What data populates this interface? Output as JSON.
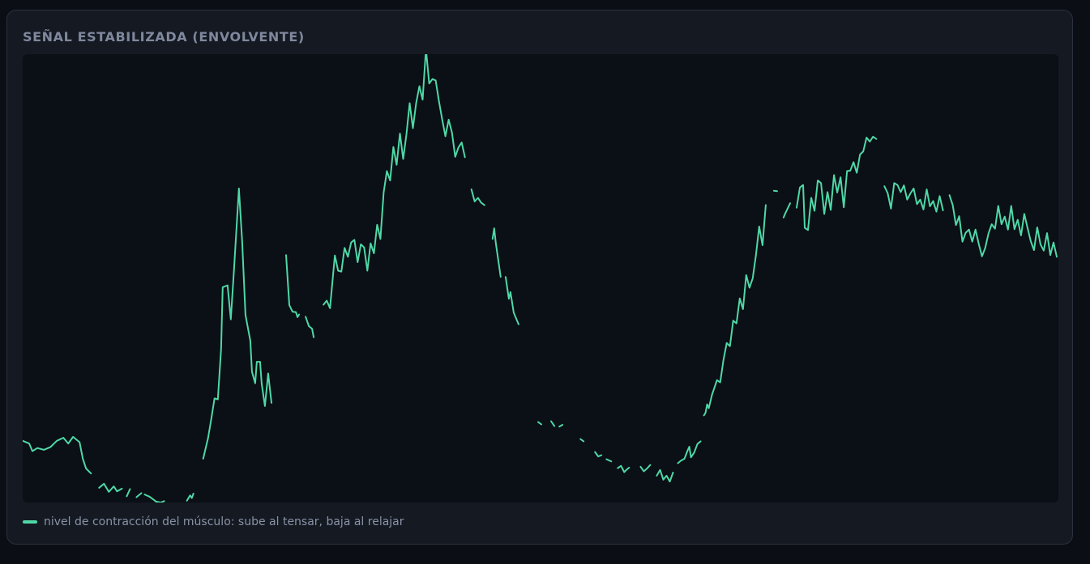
{
  "panel": {
    "title": "SEÑAL ESTABILIZADA (ENVOLVENTE)"
  },
  "colors": {
    "background": "#0b0f15",
    "panel": "#141922",
    "plot_area": "#0b0f16",
    "series": "#4fd8a6",
    "title": "#7f889c",
    "legend_text": "#8a93a6"
  },
  "chart_data": {
    "type": "line",
    "title": "SEÑAL ESTABILIZADA (ENVOLVENTE)",
    "xlabel": "",
    "ylabel": "",
    "xlim": [
      0,
      637
    ],
    "ylim": [
      0,
      100
    ],
    "grid": false,
    "axes_visible": false,
    "legend_position": "bottom-left",
    "series": [
      {
        "name": "nivel de contracción del músculo: sube al tensar, baja al relajar",
        "color": "#4fd8a6",
        "segments": [
          {
            "x": [
              0,
              4,
              6,
              9,
              13,
              17,
              21,
              25,
              28,
              31,
              35,
              37,
              39,
              42
            ],
            "y": [
              13.8,
              13.2,
              11.5,
              12.2,
              11.8,
              12.4,
              13.8,
              14.5,
              13.2,
              14.7,
              13.5,
              9.8,
              7.6,
              6.5
            ]
          },
          {
            "x": [
              47,
              50,
              53,
              56,
              58,
              61
            ],
            "y": [
              3.3,
              4.2,
              2.4,
              3.6,
              2.5,
              3.1
            ]
          },
          {
            "x": [
              64,
              66
            ],
            "y": [
              1.4,
              3.0
            ]
          },
          {
            "x": [
              70,
              73
            ],
            "y": [
              1.2,
              2.1
            ]
          },
          {
            "x": [
              75,
              78,
              81,
              82,
              85,
              87
            ],
            "y": [
              1.8,
              1.3,
              0.5,
              0.2,
              0.0,
              0.3
            ]
          },
          {
            "x": [
              101,
              103,
              104,
              105
            ],
            "y": [
              0.4,
              1.6,
              1.0,
              2.0
            ]
          },
          {
            "x": [
              111,
              114,
              116,
              118,
              120,
              122,
              123,
              126,
              128,
              130,
              133,
              135,
              137,
              140,
              141,
              143,
              144,
              146,
              147,
              149,
              151,
              153
            ],
            "y": [
              9.8,
              14.4,
              18.7,
              23.3,
              23.1,
              34.3,
              48.2,
              48.6,
              41.0,
              52.3,
              70.3,
              58.5,
              42.0,
              36.2,
              29.3,
              26.7,
              31.5,
              31.5,
              26.6,
              21.6,
              28.9,
              22.3
            ]
          },
          {
            "x": [
              162,
              164,
              166,
              168,
              169,
              170
            ],
            "y": [
              55.4,
              44.2,
              42.7,
              42.6,
              41.5,
              42.1
            ]
          },
          {
            "x": [
              174,
              176,
              178,
              179
            ],
            "y": [
              41.6,
              39.5,
              38.9,
              37.0
            ]
          },
          {
            "x": [
              185,
              187,
              189,
              192,
              194,
              196,
              198,
              200,
              202,
              204,
              206,
              208,
              210,
              212,
              214,
              216,
              218,
              220,
              222,
              224,
              226,
              228,
              230,
              232,
              234,
              236,
              238,
              240,
              242,
              244,
              246,
              248,
              250,
              252,
              254,
              256,
              258,
              260,
              262,
              264,
              266,
              268,
              270,
              272
            ],
            "y": [
              44.3,
              45.2,
              43.5,
              55.3,
              51.9,
              51.7,
              57.0,
              55.0,
              58.2,
              58.8,
              53.8,
              57.8,
              57.1,
              51.9,
              58.0,
              55.8,
              62.2,
              59.0,
              69.4,
              74.2,
              72.1,
              79.6,
              75.6,
              82.6,
              76.9,
              82.4,
              89.4,
              83.8,
              89.4,
              93.2,
              90.2,
              101.5,
              93.8,
              94.8,
              94.5,
              89.9,
              85.8,
              82.0,
              85.7,
              82.8,
              77.4,
              79.5,
              80.6,
              77.3
            ]
          },
          {
            "x": [
              276,
              278,
              280,
              282,
              284
            ],
            "y": [
              70.1,
              67.4,
              68.2,
              67.1,
              66.6
            ]
          },
          {
            "x": [
              289,
              290,
              291,
              294
            ],
            "y": [
              59.0,
              61.4,
              58.1,
              50.5
            ]
          },
          {
            "x": [
              297,
              299,
              300,
              302,
              305
            ],
            "y": [
              50.5,
              45.6,
              47.1,
              42.5,
              39.9
            ]
          },
          {
            "x": [
              317,
              319
            ],
            "y": [
              18.0,
              17.5
            ]
          },
          {
            "x": [
              325,
              327
            ],
            "y": [
              18.2,
              17.1
            ]
          },
          {
            "x": [
              330,
              332
            ],
            "y": [
              17.0,
              17.4
            ]
          },
          {
            "x": [
              343,
              345
            ],
            "y": [
              14.2,
              13.7
            ]
          },
          {
            "x": [
              352,
              354,
              356
            ],
            "y": [
              11.3,
              10.3,
              10.6
            ]
          },
          {
            "x": [
              359,
              362
            ],
            "y": [
              9.7,
              9.2
            ]
          },
          {
            "x": [
              366,
              368,
              370,
              371,
              373
            ],
            "y": [
              7.7,
              8.2,
              6.8,
              7.2,
              7.8
            ]
          },
          {
            "x": [
              380,
              382,
              384,
              386
            ],
            "y": [
              8.0,
              7.0,
              7.6,
              8.4
            ]
          },
          {
            "x": [
              390,
              392,
              394,
              396,
              398,
              400
            ],
            "y": [
              6.0,
              7.3,
              5.1,
              6.0,
              4.7,
              6.7
            ]
          },
          {
            "x": [
              403,
              405,
              407,
              409,
              410,
              411,
              413,
              415,
              417
            ],
            "y": [
              8.8,
              9.4,
              9.8,
              11.7,
              12.5,
              10.1,
              11.2,
              13.1,
              13.7
            ]
          },
          {
            "x": [
              419,
              420,
              421,
              422,
              424,
              427,
              429,
              431,
              433,
              435,
              437,
              439,
              441,
              443,
              445,
              447,
              449,
              451,
              453,
              455,
              457
            ],
            "y": [
              19.5,
              20.1,
              22.0,
              21.1,
              24.2,
              27.4,
              26.9,
              31.9,
              35.7,
              35.0,
              40.7,
              40.1,
              45.7,
              43.3,
              50.9,
              48.1,
              50.2,
              55.4,
              61.8,
              57.6,
              66.6
            ]
          },
          {
            "x": [
              462,
              464
            ],
            "y": [
              69.8,
              69.7
            ]
          },
          {
            "x": [
              468,
              469,
              472
            ],
            "y": [
              63.8,
              64.7,
              67.0
            ]
          },
          {
            "x": [
              476,
              478,
              480,
              481,
              483,
              485,
              487,
              489,
              491,
              493,
              495,
              497,
              499,
              501,
              503,
              505,
              507,
              509,
              511,
              513,
              515,
              517,
              519,
              521,
              523,
              525
            ],
            "y": [
              66.0,
              70.5,
              71.1,
              61.5,
              61.0,
              68.2,
              65.3,
              72.1,
              71.5,
              64.6,
              69.5,
              65.5,
              73.3,
              69.4,
              72.8,
              66.1,
              74.2,
              74.3,
              76.2,
              73.8,
              77.9,
              78.6,
              81.7,
              80.8,
              81.9,
              81.4
            ]
          },
          {
            "x": [
              530,
              532,
              534,
              536,
              538,
              540,
              542,
              544,
              546,
              548,
              550,
              552,
              554,
              556,
              558,
              560,
              562,
              564,
              566
            ],
            "y": [
              70.8,
              69.3,
              65.8,
              71.5,
              71.1,
              69.5,
              71.0,
              67.8,
              69.2,
              70.3,
              66.8,
              67.8,
              65.6,
              70.1,
              66.3,
              67.5,
              65.1,
              68.6,
              65.4
            ]
          },
          {
            "x": [
              570,
              572,
              574,
              576,
              578,
              580,
              582,
              584,
              586,
              588,
              590,
              592,
              594,
              596,
              598,
              600,
              602,
              604,
              606,
              608,
              610,
              612,
              614,
              616,
              618,
              620,
              622,
              624,
              626,
              628,
              630,
              632,
              634,
              636
            ],
            "y": [
              68.8,
              66.6,
              62.1,
              64.1,
              58.4,
              60.4,
              61.1,
              58.4,
              61.1,
              57.9,
              55.1,
              57.0,
              60.2,
              62.3,
              61.3,
              66.4,
              62.3,
              64.0,
              61.1,
              66.4,
              61.2,
              63.3,
              59.8,
              64.6,
              61.5,
              58.5,
              56.5,
              61.6,
              57.8,
              56.4,
              60.3,
              55.4,
              58.2,
              55.0
            ]
          }
        ]
      }
    ]
  },
  "legend": {
    "label": "nivel de contracción del músculo: sube al tensar, baja al relajar"
  }
}
